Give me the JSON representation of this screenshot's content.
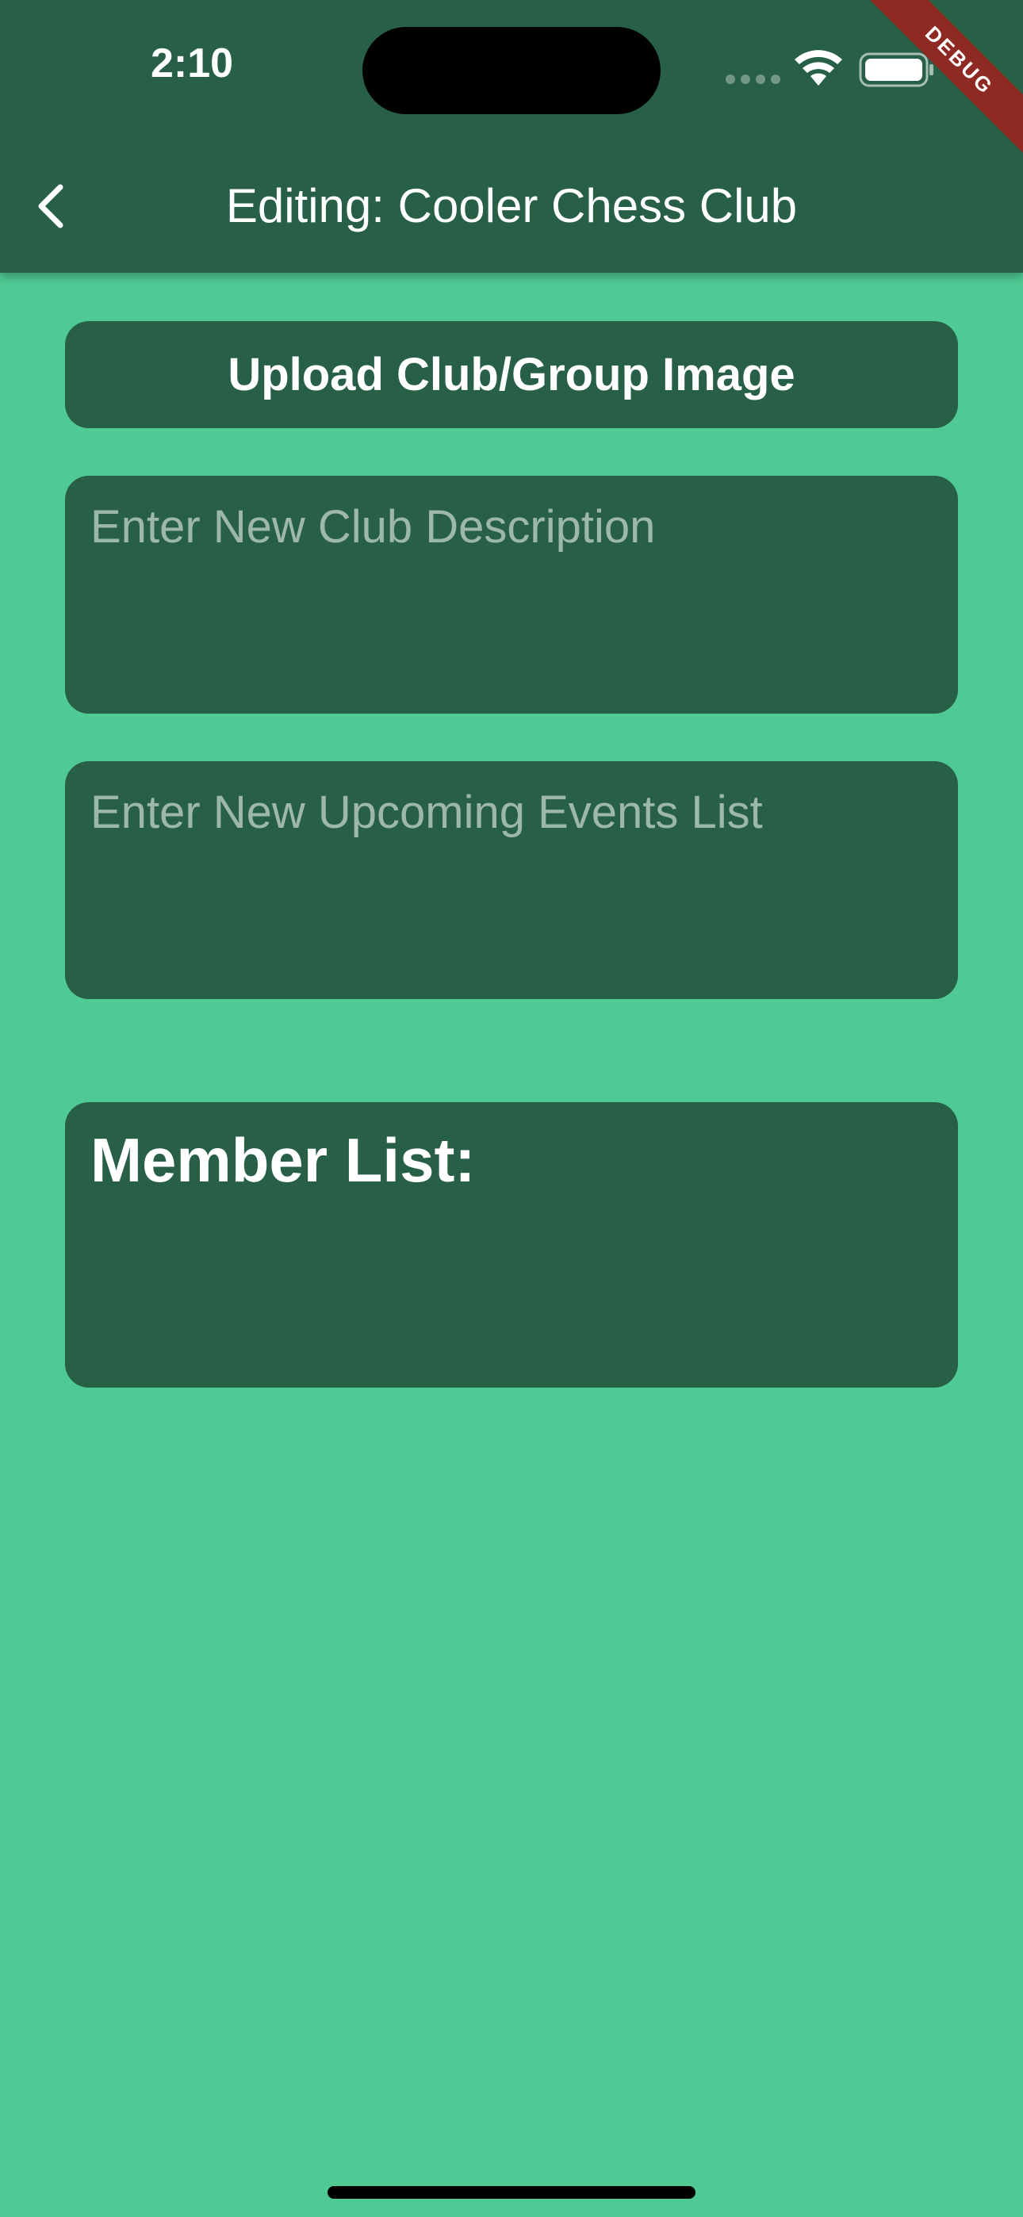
{
  "status_bar": {
    "time": "2:10"
  },
  "debug_banner": "DEBUG",
  "app_bar": {
    "title": "Editing: Cooler Chess Club",
    "back_icon": "chevron-left-icon"
  },
  "upload_button": {
    "label": "Upload Club/Group Image"
  },
  "description_field": {
    "placeholder": "Enter New Club Description",
    "value": ""
  },
  "events_field": {
    "placeholder": "Enter New Upcoming Events List",
    "value": ""
  },
  "member_list": {
    "title": "Member List:",
    "members": []
  },
  "colors": {
    "background": "#50CA94",
    "app_bar": "#276047",
    "card": "#276047",
    "debug_ribbon": "#8E2A23"
  }
}
